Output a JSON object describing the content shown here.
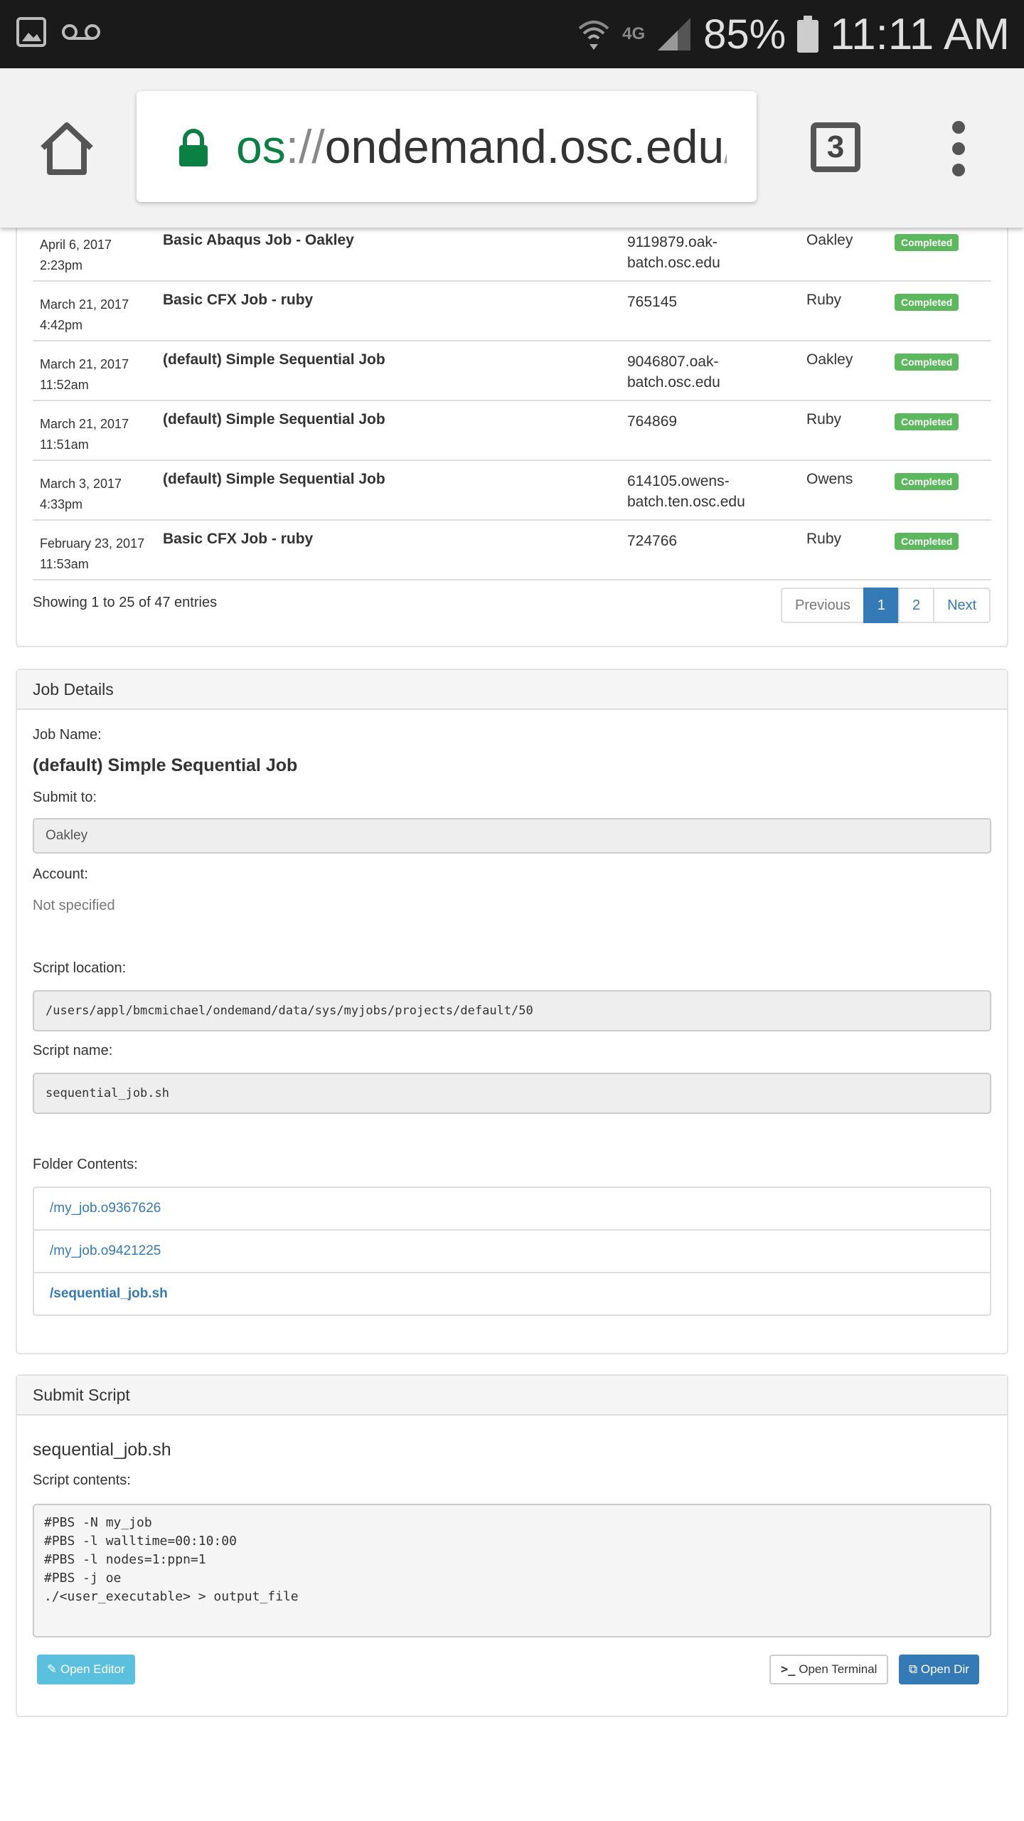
{
  "status_bar": {
    "battery": "85%",
    "time": "11:11 AM",
    "network": "4G",
    "icons": [
      "image-icon",
      "voicemail-icon",
      "wifi-icon",
      "signal-icon",
      "battery-icon"
    ]
  },
  "browser": {
    "url_scheme": "os",
    "url_sep": "://",
    "url_host": "ondemand.osc.edu",
    "url_path": "/p",
    "tab_count": "3"
  },
  "jobs": {
    "rows": [
      {
        "date": "April 6, 2017",
        "time": "2:23pm",
        "name": "Basic Abaqus Job - Oakley",
        "id_line1": "9119879.oak-",
        "id_line2": "batch.osc.edu",
        "cluster": "Oakley",
        "status": "Completed"
      },
      {
        "date": "March 21, 2017",
        "time": "4:42pm",
        "name": "Basic CFX Job - ruby",
        "id_line1": "765145",
        "id_line2": "",
        "cluster": "Ruby",
        "status": "Completed"
      },
      {
        "date": "March 21, 2017",
        "time": "11:52am",
        "name": "(default) Simple Sequential Job",
        "id_line1": "9046807.oak-",
        "id_line2": "batch.osc.edu",
        "cluster": "Oakley",
        "status": "Completed"
      },
      {
        "date": "March 21, 2017",
        "time": "11:51am",
        "name": "(default) Simple Sequential Job",
        "id_line1": "764869",
        "id_line2": "",
        "cluster": "Ruby",
        "status": "Completed"
      },
      {
        "date": "March 3, 2017",
        "time": "4:33pm",
        "name": "(default) Simple Sequential Job",
        "id_line1": "614105.owens-",
        "id_line2": "batch.ten.osc.edu",
        "cluster": "Owens",
        "status": "Completed"
      },
      {
        "date": "February 23, 2017",
        "time": "11:53am",
        "name": "Basic CFX Job - ruby",
        "id_line1": "724766",
        "id_line2": "",
        "cluster": "Ruby",
        "status": "Completed"
      }
    ],
    "showing": "Showing 1 to 25 of 47 entries",
    "pager": {
      "prev": "Previous",
      "p1": "1",
      "p2": "2",
      "next": "Next"
    }
  },
  "details": {
    "heading": "Job Details",
    "job_name_label": "Job Name:",
    "job_name": "(default) Simple Sequential Job",
    "submit_label": "Submit to:",
    "submit_value": "Oakley",
    "account_label": "Account:",
    "account_value": "Not specified",
    "script_loc_label": "Script location:",
    "script_loc_value": "/users/appl/bmcmichael/ondemand/data/sys/myjobs/projects/default/50",
    "script_name_label": "Script name:",
    "script_name_value": "sequential_job.sh",
    "folder_label": "Folder Contents:",
    "folder_items": [
      "/my_job.o9367626",
      "/my_job.o9421225",
      "/sequential_job.sh"
    ]
  },
  "submit_script": {
    "heading": "Submit Script",
    "filename": "sequential_job.sh",
    "contents_label": "Script contents:",
    "code": "#PBS -N my_job\n#PBS -l walltime=00:10:00\n#PBS -l nodes=1:ppn=1\n#PBS -j oe\n./<user_executable> > output_file",
    "open_editor": "Open Editor",
    "open_terminal": "Open Terminal",
    "open_dir": "Open Dir"
  }
}
